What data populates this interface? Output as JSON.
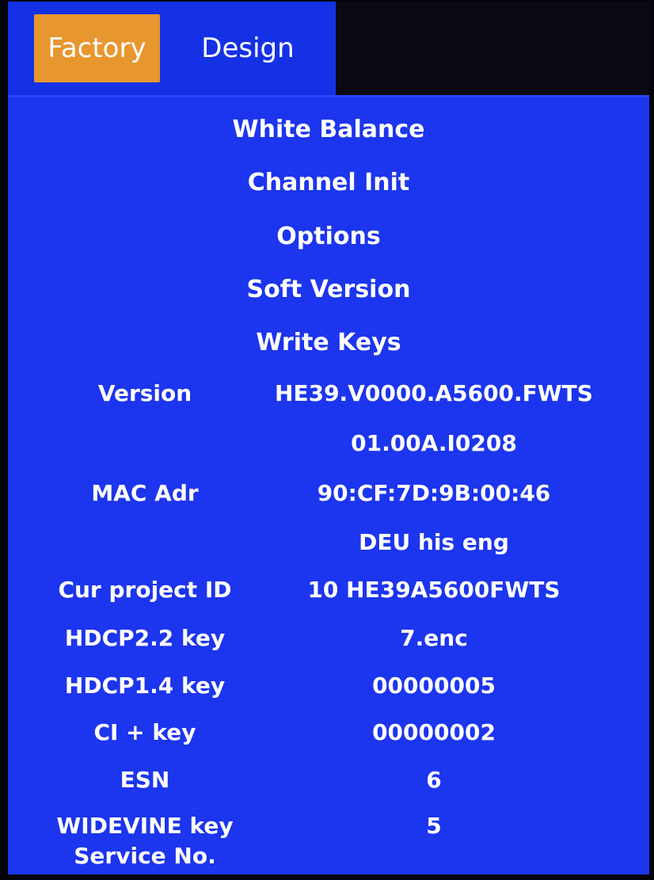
{
  "tabs": {
    "factory": "Factory",
    "design": "Design"
  },
  "menu": [
    "White Balance",
    "Channel Init",
    "Options",
    "Soft Version",
    "Write Keys"
  ],
  "info_rows": [
    {
      "label": "Version",
      "value": "HE39.V0000.A5600.FWTS"
    },
    {
      "label": "",
      "value": "01.00A.I0208"
    },
    {
      "label": "MAC Adr",
      "value": "90:CF:7D:9B:00:46"
    },
    {
      "label": "",
      "value": "DEU his eng"
    },
    {
      "label": "Cur project ID",
      "value": "10 HE39A5600FWTS"
    },
    {
      "label": "HDCP2.2 key",
      "value": "7.enc"
    },
    {
      "label": "HDCP1.4 key",
      "value": "00000005"
    },
    {
      "label": "CI + key",
      "value": "00000002"
    },
    {
      "label": "ESN",
      "value": "6"
    },
    {
      "label": "WIDEVINE key",
      "value": "5"
    },
    {
      "label": "Service No.",
      "value": ""
    }
  ],
  "colors": {
    "panel": "#1c35ee",
    "tab_active": "#e8962e",
    "text": "#ffffff"
  }
}
